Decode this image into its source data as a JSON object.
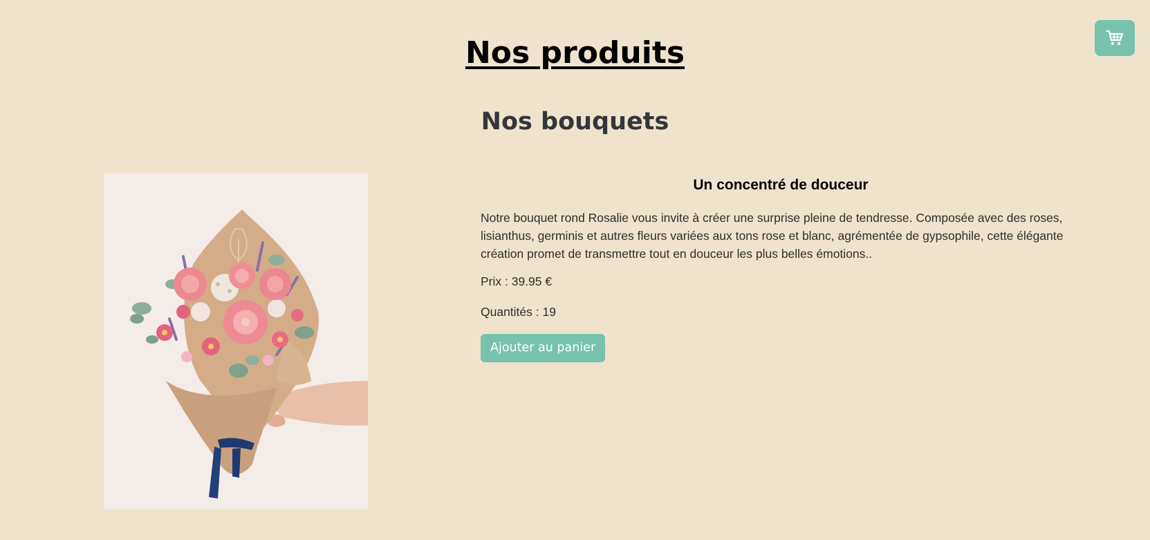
{
  "header": {
    "title": "Nos produits",
    "cart_icon": "shopping-cart-icon"
  },
  "section": {
    "title": "Nos bouquets"
  },
  "product": {
    "image_subject": "bouquet-photo",
    "name": "Un concentré de douceur",
    "description": "Notre bouquet rond Rosalie vous invite à créer une surprise pleine de tendresse. Composée avec des roses, lisianthus, germinis et autres fleurs variées aux tons rose et blanc, agrémentée de gypsophile, cette élégante création promet de transmettre tout en douceur les plus belles émotions..",
    "price_text": "Prix : 39.95  €",
    "quantity_text": "Quantités : 19",
    "add_button_label": "Ajouter au panier"
  },
  "colors": {
    "background": "#efe3cd",
    "accent": "#76c2ad"
  }
}
